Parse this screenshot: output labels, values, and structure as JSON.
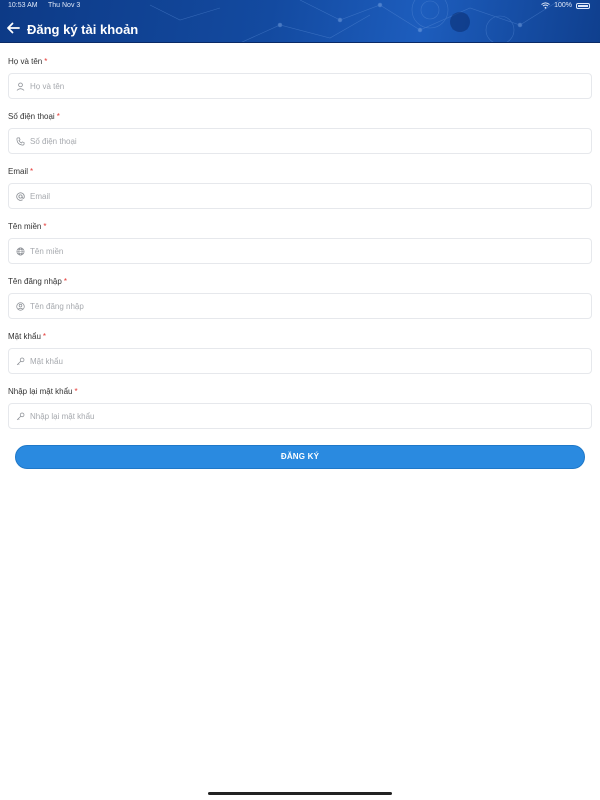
{
  "status_bar": {
    "time": "10:53 AM",
    "date": "Thu Nov 3",
    "battery": "100%"
  },
  "header": {
    "title": "Đăng ký tài khoản"
  },
  "form": {
    "fields": [
      {
        "label": "Họ và tên",
        "required_mark": "*",
        "placeholder": "Họ và tên",
        "value": "",
        "icon": "person-icon"
      },
      {
        "label": "Số điện thoại",
        "required_mark": "*",
        "placeholder": "Số điện thoại",
        "value": "",
        "icon": "phone-icon"
      },
      {
        "label": "Email",
        "required_mark": "*",
        "placeholder": "Email",
        "value": "",
        "icon": "at-icon"
      },
      {
        "label": "Tên miền",
        "required_mark": "*",
        "placeholder": "Tên miền",
        "value": "",
        "icon": "globe-icon"
      },
      {
        "label": "Tên đăng nhập",
        "required_mark": "*",
        "placeholder": "Tên đăng nhập",
        "value": "",
        "icon": "account-circle-icon"
      },
      {
        "label": "Mật khẩu",
        "required_mark": "*",
        "placeholder": "Mật khẩu",
        "value": "",
        "icon": "key-icon"
      },
      {
        "label": "Nhập lại mật khẩu",
        "required_mark": "*",
        "placeholder": "Nhập lại mật khẩu",
        "value": "",
        "icon": "key-icon"
      }
    ],
    "submit_label": "ĐĂNG KÝ"
  },
  "colors": {
    "header_bg": "#134aa0",
    "accent": "#2a8ae0",
    "required": "#e53935",
    "placeholder": "#a6a9ae"
  }
}
